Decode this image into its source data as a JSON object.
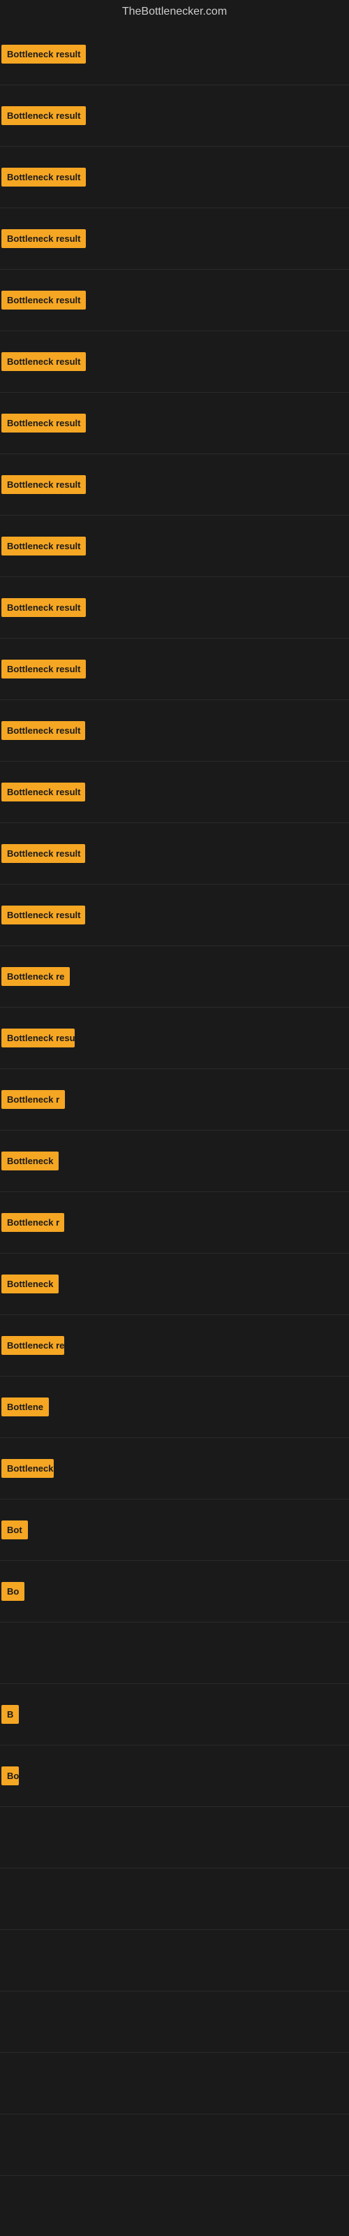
{
  "site": {
    "title": "TheBottlenecker.com"
  },
  "rows": [
    {
      "id": 1,
      "label": "Bottleneck result",
      "widthClass": "w-full"
    },
    {
      "id": 2,
      "label": "Bottleneck result",
      "widthClass": "w-full"
    },
    {
      "id": 3,
      "label": "Bottleneck result",
      "widthClass": "w-full"
    },
    {
      "id": 4,
      "label": "Bottleneck result",
      "widthClass": "w-full"
    },
    {
      "id": 5,
      "label": "Bottleneck result",
      "widthClass": "w-full"
    },
    {
      "id": 6,
      "label": "Bottleneck result",
      "widthClass": "w-full"
    },
    {
      "id": 7,
      "label": "Bottleneck result",
      "widthClass": "w-full"
    },
    {
      "id": 8,
      "label": "Bottleneck result",
      "widthClass": "w-full"
    },
    {
      "id": 9,
      "label": "Bottleneck result",
      "widthClass": "w-full"
    },
    {
      "id": 10,
      "label": "Bottleneck result",
      "widthClass": "w-full"
    },
    {
      "id": 11,
      "label": "Bottleneck result",
      "widthClass": "w-full"
    },
    {
      "id": 12,
      "label": "Bottleneck result",
      "widthClass": "w-large"
    },
    {
      "id": 13,
      "label": "Bottleneck result",
      "widthClass": "w-large"
    },
    {
      "id": 14,
      "label": "Bottleneck result",
      "widthClass": "w-large"
    },
    {
      "id": 15,
      "label": "Bottleneck result",
      "widthClass": "w-large"
    },
    {
      "id": 16,
      "label": "Bottleneck re",
      "widthClass": "w-medium"
    },
    {
      "id": 17,
      "label": "Bottleneck result",
      "widthClass": "w-medium"
    },
    {
      "id": 18,
      "label": "Bottleneck r",
      "widthClass": "w-medium"
    },
    {
      "id": 19,
      "label": "Bottleneck",
      "widthClass": "w-small"
    },
    {
      "id": 20,
      "label": "Bottleneck r",
      "widthClass": "w-small"
    },
    {
      "id": 21,
      "label": "Bottleneck",
      "widthClass": "w-small"
    },
    {
      "id": 22,
      "label": "Bottleneck res",
      "widthClass": "w-small"
    },
    {
      "id": 23,
      "label": "Bottlene",
      "widthClass": "w-xsmall"
    },
    {
      "id": 24,
      "label": "Bottleneck r",
      "widthClass": "w-xsmall"
    },
    {
      "id": 25,
      "label": "Bot",
      "widthClass": "w-tiny"
    },
    {
      "id": 26,
      "label": "Bo",
      "widthClass": "w-tiny"
    },
    {
      "id": 27,
      "label": "",
      "widthClass": "w-xtiny"
    },
    {
      "id": 28,
      "label": "B",
      "widthClass": "w-micro"
    },
    {
      "id": 29,
      "label": "Bottl",
      "widthClass": "w-nano"
    },
    {
      "id": 30,
      "label": "",
      "widthClass": "w-pico"
    },
    {
      "id": 31,
      "label": "",
      "widthClass": "w-femto"
    },
    {
      "id": 32,
      "label": "",
      "widthClass": "w-femto"
    },
    {
      "id": 33,
      "label": "",
      "widthClass": "w-femto"
    },
    {
      "id": 34,
      "label": "",
      "widthClass": "w-femto"
    },
    {
      "id": 35,
      "label": "",
      "widthClass": "w-femto"
    }
  ]
}
